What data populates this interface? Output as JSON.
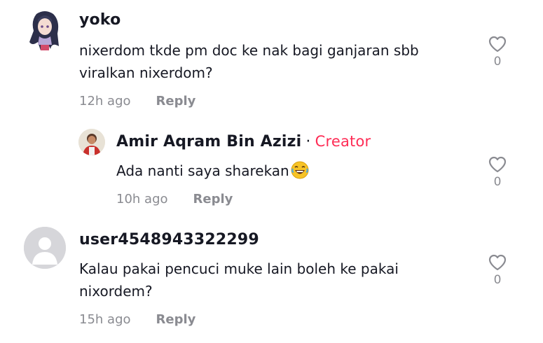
{
  "comments": [
    {
      "username": "yoko",
      "text_line1": "nixerdom tkde pm doc ke nak bagi ganjaran sbb",
      "text_line2": "viralkan nixerdom?",
      "time": "12h ago",
      "reply_label": "Reply",
      "likes": "0",
      "avatar_icon": "anime-avatar"
    },
    {
      "username": "Amir Aqram Bin Azizi",
      "separator": "·",
      "badge": "Creator",
      "text": "Ada nanti saya sharekan",
      "emoji": "😂",
      "time": "10h ago",
      "reply_label": "Reply",
      "likes": "0",
      "avatar_icon": "photo-avatar"
    },
    {
      "username": "user4548943322299",
      "text_line1": "Kalau pakai pencuci muke lain boleh ke pakai",
      "text_line2": "nixordem?",
      "time": "15h ago",
      "reply_label": "Reply",
      "likes": "0",
      "avatar_icon": "default-avatar"
    }
  ],
  "colors": {
    "creator": "#fe2c55",
    "muted": "#8a8b91",
    "text": "#161823"
  }
}
